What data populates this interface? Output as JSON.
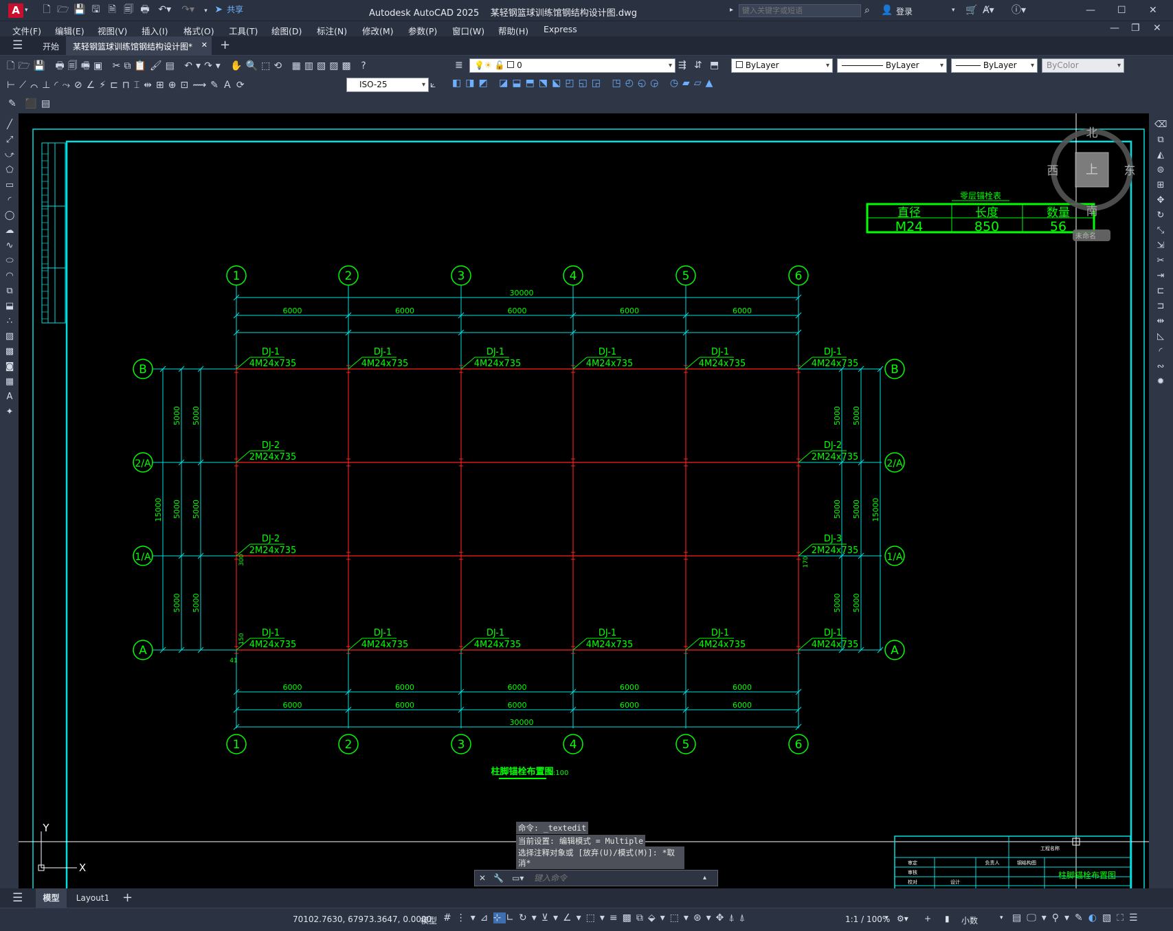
{
  "app": {
    "title": "Autodesk AutoCAD 2025",
    "file": "某轻钢篮球训练馆钢结构设计图.dwg",
    "search_placeholder": "键入关键字或短语",
    "login": "登录",
    "share": "共享"
  },
  "menu": [
    "文件(F)",
    "编辑(E)",
    "视图(V)",
    "插入(I)",
    "格式(O)",
    "工具(T)",
    "绘图(D)",
    "标注(N)",
    "修改(M)",
    "参数(P)",
    "窗口(W)",
    "帮助(H)",
    "Express"
  ],
  "tabs": {
    "start": "开始",
    "doc": "某轻钢篮球训练馆钢结构设计图*"
  },
  "toolbar": {
    "layer": "0",
    "color": "ByLayer",
    "linetype": "ByLayer",
    "lineweight": "ByLayer",
    "plotstyle": "ByColor",
    "dimstyle": "ISO-25"
  },
  "viewcube": {
    "north": "北",
    "south": "南",
    "east": "东",
    "west": "西",
    "top": "上",
    "wcs": "未命名"
  },
  "anchor_table": {
    "title": "零层锚栓表",
    "headers": [
      "直径",
      "长度",
      "数量"
    ],
    "row": [
      "M24",
      "850",
      "56"
    ]
  },
  "grid": {
    "columns": [
      "1",
      "2",
      "3",
      "4",
      "5",
      "6"
    ],
    "rows": [
      "B",
      "2/A",
      "1/A",
      "A"
    ]
  },
  "dims": {
    "total": "30000",
    "bay": "6000",
    "row_bay": "5000",
    "row_total": "15000"
  },
  "labels": {
    "dj1": "DJ-1",
    "dj2": "DJ-2",
    "dj3": "DJ-3",
    "b4": "4M24x735",
    "b2": "2M24x735",
    "small1": "300",
    "small2": "150",
    "small3": "41",
    "small4": "170"
  },
  "drawing_title": {
    "name": "柱脚锚栓布置图",
    "scale": "1:100"
  },
  "titleblock": {
    "sheet": "柱脚锚栓布置图",
    "project": "工程名称",
    "c1": "审定",
    "c2": "审核",
    "c3": "校对",
    "c4": "设计",
    "c5": "负责人",
    "c6": "钢结构图"
  },
  "command": {
    "line1": "命令: _textedit",
    "line2": "当前设置: 编辑模式 = Multiple",
    "line3": "选择注释对象或 [放弃(U)/模式(M)]: *取",
    "line4": "消*",
    "placeholder": "键入命令"
  },
  "layout_tabs": [
    "模型",
    "Layout1"
  ],
  "status": {
    "coords": "70102.7630, 67973.3647, 0.0000",
    "model": "模型",
    "scale": "1:1 / 100%",
    "units": "小数"
  },
  "ucs": {
    "x": "X",
    "y": "Y"
  }
}
